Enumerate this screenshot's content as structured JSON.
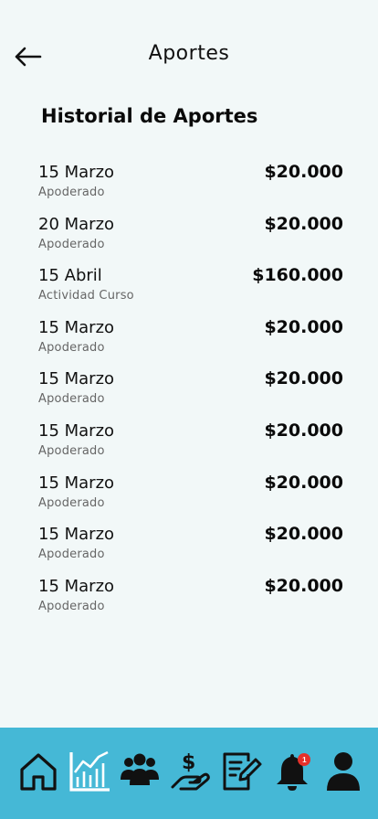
{
  "header": {
    "title": "Aportes",
    "back_icon": "arrow-left-icon"
  },
  "section": {
    "title": "Historial de Aportes"
  },
  "contributions": [
    {
      "date": "15 Marzo",
      "source": "Apoderado",
      "amount": "$20.000"
    },
    {
      "date": "20 Marzo",
      "source": "Apoderado",
      "amount": "$20.000"
    },
    {
      "date": "15 Abril",
      "source": "Actividad Curso",
      "amount": "$160.000"
    },
    {
      "date": "15 Marzo",
      "source": "Apoderado",
      "amount": "$20.000"
    },
    {
      "date": "15 Marzo",
      "source": "Apoderado",
      "amount": "$20.000"
    },
    {
      "date": "15 Marzo",
      "source": "Apoderado",
      "amount": "$20.000"
    },
    {
      "date": "15 Marzo",
      "source": "Apoderado",
      "amount": "$20.000"
    },
    {
      "date": "15 Marzo",
      "source": "Apoderado",
      "amount": "$20.000"
    },
    {
      "date": "15 Marzo",
      "source": "Apoderado",
      "amount": "$20.000"
    }
  ],
  "nav": {
    "background": "#45b8d6",
    "items": [
      {
        "icon": "home-icon"
      },
      {
        "icon": "chart-icon"
      },
      {
        "icon": "group-icon"
      },
      {
        "icon": "payment-hand-icon"
      },
      {
        "icon": "edit-document-icon"
      },
      {
        "icon": "bell-icon",
        "badge": "1"
      },
      {
        "icon": "user-icon"
      }
    ]
  }
}
